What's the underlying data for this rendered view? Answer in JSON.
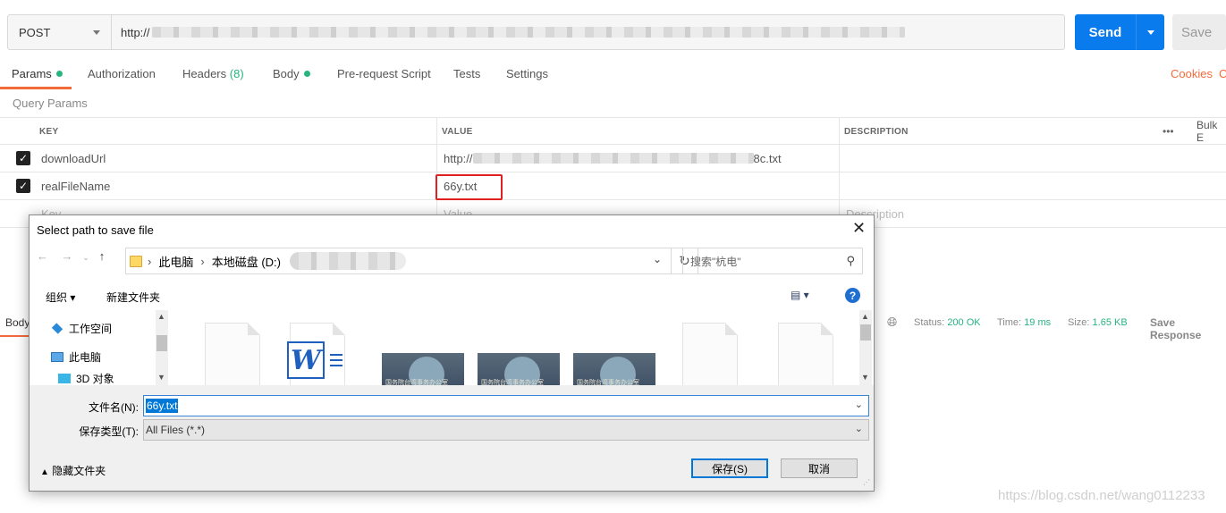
{
  "request": {
    "method": "POST",
    "url_prefix": "http://",
    "send_label": "Send",
    "save_label": "Save"
  },
  "tabs": [
    {
      "label": "Params"
    },
    {
      "label": "Authorization"
    },
    {
      "label": "Headers",
      "count": "(8)"
    },
    {
      "label": "Body"
    },
    {
      "label": "Pre-request Script"
    },
    {
      "label": "Tests"
    },
    {
      "label": "Settings"
    }
  ],
  "tab_right": {
    "cookies": "Cookies",
    "code": "C"
  },
  "query_params_label": "Query Params",
  "params_table": {
    "headers": {
      "key": "KEY",
      "value": "VALUE",
      "description": "DESCRIPTION",
      "more": "•••",
      "bulk": "Bulk E"
    },
    "rows": [
      {
        "key": "downloadUrl",
        "value_prefix": "http://",
        "value_suffix": "8c.txt"
      },
      {
        "key": "realFileName",
        "value": "66y.txt"
      }
    ],
    "placeholders": {
      "key": "Key",
      "value": "Value",
      "description": "Description"
    }
  },
  "response": {
    "body_label": "Body",
    "status_label": "Status:",
    "status_value": "200 OK",
    "time_label": "Time:",
    "time_value": "19 ms",
    "size_label": "Size:",
    "size_value": "1.65 KB",
    "save_response": "Save Response"
  },
  "dialog": {
    "title": "Select path to save file",
    "path": [
      "此电脑",
      "本地磁盘 (D:)"
    ],
    "search_placeholder": "搜索\"杭电\"",
    "toolbar": {
      "organize": "组织 ▾",
      "new_folder": "新建文件夹"
    },
    "nav_items": [
      "工作空间",
      "此电脑",
      "3D 对象"
    ],
    "filename_label": "文件名(N):",
    "filename_value": "66y.txt",
    "filetype_label": "保存类型(T):",
    "filetype_value": "All Files (*.*)",
    "hide_folders": "隐藏文件夹",
    "save_button": "保存(S)",
    "cancel_button": "取消",
    "thumb_caption": "国务院台湾事务办公室"
  },
  "watermark": "https://blog.csdn.net/wang0112233",
  "colors": {
    "accent": "#f26b3a",
    "send": "#097bed",
    "success": "#26b47f",
    "highlight": "#e02020"
  }
}
